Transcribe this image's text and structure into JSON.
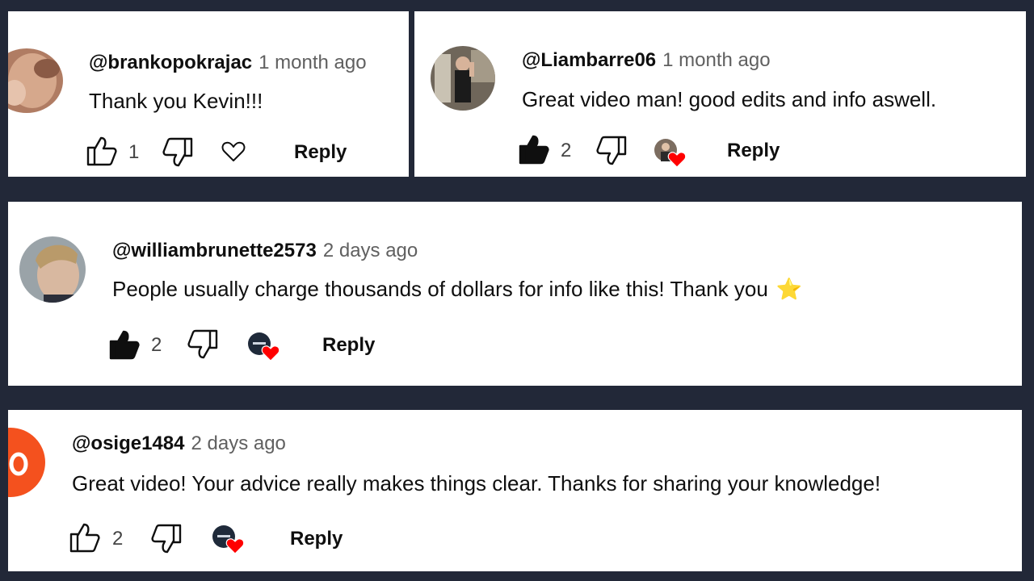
{
  "comments": [
    {
      "author": "@brankopokrajac",
      "time": "1 month ago",
      "text": "Thank you Kevin!!!",
      "likes": "1",
      "liked": false,
      "creator_heart": false,
      "reply_label": "Reply"
    },
    {
      "author": "@Liambarre06",
      "time": "1 month ago",
      "text": "Great video man! good edits and info aswell.",
      "likes": "2",
      "liked": true,
      "creator_heart": true,
      "reply_label": "Reply"
    },
    {
      "author": "@williambrunette2573",
      "time": "2 days ago",
      "text": "People usually charge thousands of dollars for info like this! Thank you",
      "emoji": "⭐",
      "likes": "2",
      "liked": true,
      "creator_heart": true,
      "reply_label": "Reply"
    },
    {
      "author": "@osige1484",
      "time": "2 days ago",
      "text": "Great video! Your advice really makes things clear. Thanks for sharing your knowledge!",
      "likes": "2",
      "liked": false,
      "creator_heart": true,
      "reply_label": "Reply"
    }
  ],
  "colors": {
    "background": "#222838",
    "card": "#ffffff",
    "heart": "#ff0000",
    "avatar_orange": "#f4511e"
  }
}
